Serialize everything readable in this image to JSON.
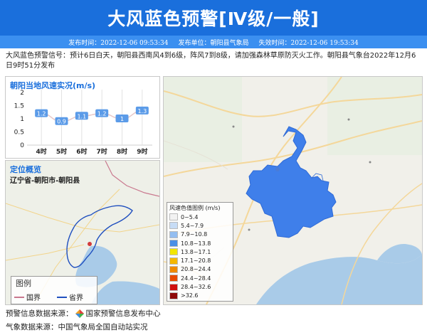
{
  "header": {
    "title": "大风蓝色预警[Ⅳ级/一般]"
  },
  "meta": {
    "publish": "发布时间：2022-12-06 09:53:34",
    "unit": "发布单位：朝阳县气象局",
    "expire": "失效时间：2022-12-06 19:53:34"
  },
  "description": "大风蓝色预警信号：预计6日白天，朝阳县西南风4到6级，阵风7到8级，请加强森林草原防灭火工作。朝阳县气象台2022年12月6日9时51分发布",
  "wind_panel": {
    "title": "朝阳当地风速实况(m/s)"
  },
  "chart_data": {
    "type": "line",
    "title": "朝阳当地风速实况(m/s)",
    "categories": [
      "4时",
      "5时",
      "6时",
      "7时",
      "8时",
      "9时"
    ],
    "values": [
      1.2,
      0.9,
      1.1,
      1.2,
      1,
      1.3
    ],
    "value_labels": [
      "1.2",
      "0.9",
      "1.1",
      "1.2",
      "1",
      "1.3"
    ],
    "yticks": [
      "0",
      "0.5",
      "1",
      "1.5",
      "2"
    ],
    "ylim": [
      0,
      2
    ],
    "color": "#5b9be8",
    "line_color": "#e8c8c8"
  },
  "location_panel": {
    "title": "定位概览",
    "subtitle": "辽宁省-朝阳市-朝阳县"
  },
  "map_legend": {
    "title": "图例",
    "items": [
      {
        "label": "国界",
        "color": "#c9788e"
      },
      {
        "label": "省界",
        "color": "#1f4fbf"
      }
    ]
  },
  "wind_legend": {
    "title": "风速色值图例 (m/s)",
    "items": [
      {
        "label": "0~5.4",
        "color": "#f2f2f2"
      },
      {
        "label": "5.4~7.9",
        "color": "#c7dcf5"
      },
      {
        "label": "7.9~10.8",
        "color": "#93bdf0"
      },
      {
        "label": "10.8~13.8",
        "color": "#4a8fe6"
      },
      {
        "label": "13.8~17.1",
        "color": "#f2e600"
      },
      {
        "label": "17.1~20.8",
        "color": "#f5b800"
      },
      {
        "label": "20.8~24.4",
        "color": "#f08a00"
      },
      {
        "label": "24.4~28.4",
        "color": "#e84a00"
      },
      {
        "label": "28.4~32.6",
        "color": "#d01010"
      },
      {
        "label": ">32.6",
        "color": "#8e0a0a"
      }
    ]
  },
  "footer": {
    "warning_source_label": "预警信息数据来源：",
    "warning_source": "国家预警信息发布中心",
    "weather_source": "气象数据来源：中国气象局全国自动站实况"
  }
}
